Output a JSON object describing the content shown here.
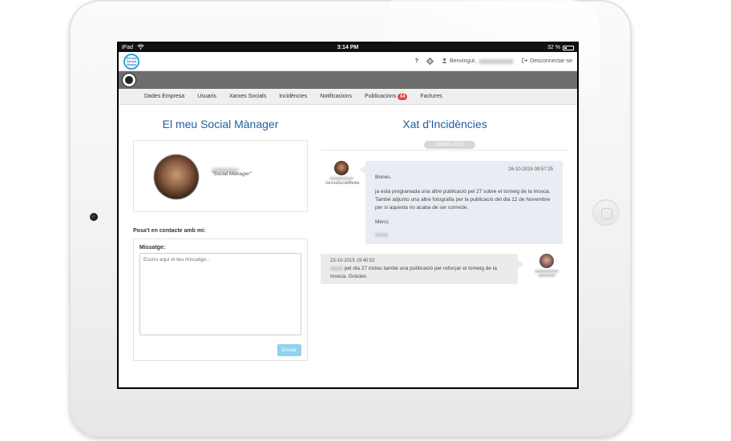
{
  "statusbar": {
    "device": "iPad",
    "time": "3:14 PM",
    "battery": "32 %"
  },
  "topbar": {
    "logo_text": "Girona Social Media",
    "help": "?",
    "welcome": "Benvingut,",
    "logout": "Desconnectar-se"
  },
  "menu": {
    "items": [
      "Dades Empresa",
      "Usuaris",
      "Xarxes Socials",
      "Incidències",
      "Notificacions",
      "Publicacions",
      "Factures"
    ],
    "publicacions_badge": "64"
  },
  "left": {
    "title": "El meu Social Mànager",
    "role": "\"Social Manager\"",
    "contact_label": "Posa't en contacte amb mi:",
    "message_label": "Missatge:",
    "message_placeholder": "Escriu aquí el teu missatge...",
    "send_label": "Enviar"
  },
  "right": {
    "title": "Xat d'Incidències",
    "date_pill": "Octubre 2015",
    "msg1": {
      "company": "GironaSocialMedia",
      "timestamp": "26-10-2015   09:57:25",
      "greeting": "Bones,",
      "body": "ja està programada una altre publicació pel 27 sobre el torneig de la mosca. També adjunto una altre fotografia per la publicació del dia 12 de Novembre per si aquesta no acaba de ser correcte.",
      "closing": "Merci,"
    },
    "msg2": {
      "timestamp": "23-10-2015   19:40:52",
      "body": "pel dia 27 inclou també una publicació per reforçar el torneig de la mosca. Gràcies"
    }
  },
  "colors": {
    "accent": "#1f5fa0",
    "badge": "#e8403f",
    "button": "#8fd2ef"
  }
}
